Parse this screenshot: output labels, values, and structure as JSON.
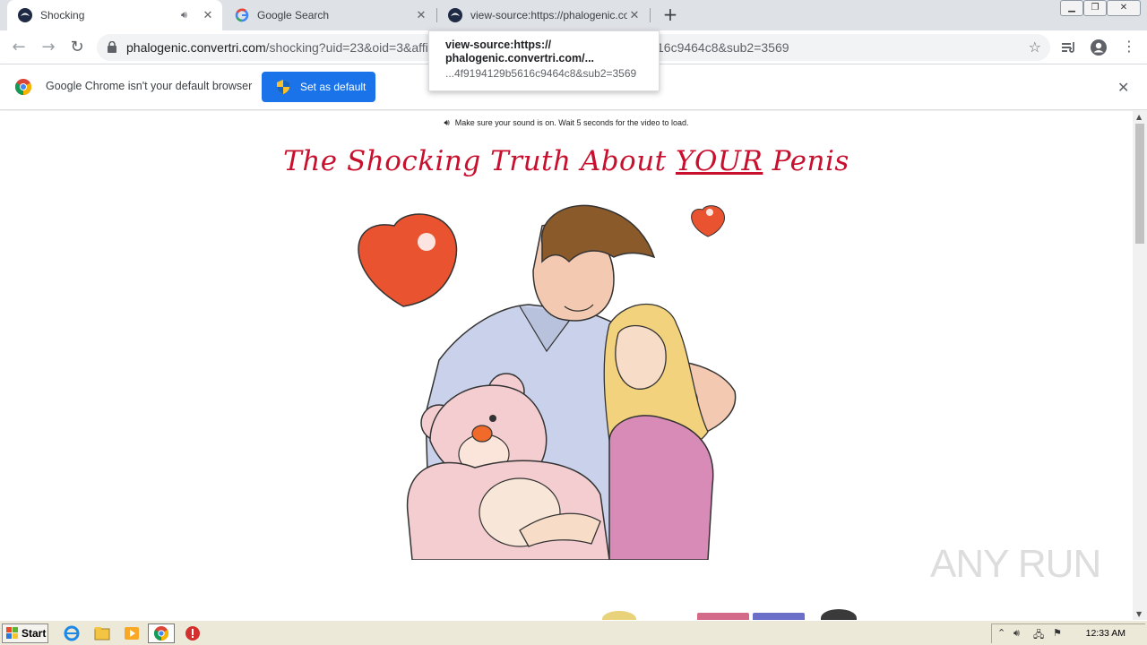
{
  "tabs": [
    {
      "title": "Shocking",
      "active": true,
      "audio": true
    },
    {
      "title": "Google Search",
      "active": false,
      "audio": false
    },
    {
      "title": "view-source:https://phalogenic.convertri.com",
      "active": false,
      "audio": false
    }
  ],
  "toolbar": {
    "url_host": "phalogenic.convertri.com",
    "url_path": "/shocking?uid=23&oid=3&affi",
    "url_path_tail": "16c9464c8&sub2=3569"
  },
  "tooltip": {
    "line1": "view-source:https://",
    "line2": "phalogenic.convertri.com/...",
    "line3": "...4f9194129b5616c9464c8&sub2=3569"
  },
  "infobar": {
    "message": "Google Chrome isn't your default browser",
    "button_label": "Set as default"
  },
  "page": {
    "notice": "Make sure your sound is on. Wait 5 seconds for the video to load.",
    "headline_pre": "The Shocking Truth About ",
    "headline_emph": "YOUR",
    "headline_post": " Penis"
  },
  "watermark": "ANY RUN",
  "taskbar": {
    "start_label": "Start",
    "clock": "12:33 AM"
  },
  "colors": {
    "headline": "#c8102e",
    "setdefault_bg": "#1a73e8",
    "tabstrip": "#dee1e6"
  }
}
